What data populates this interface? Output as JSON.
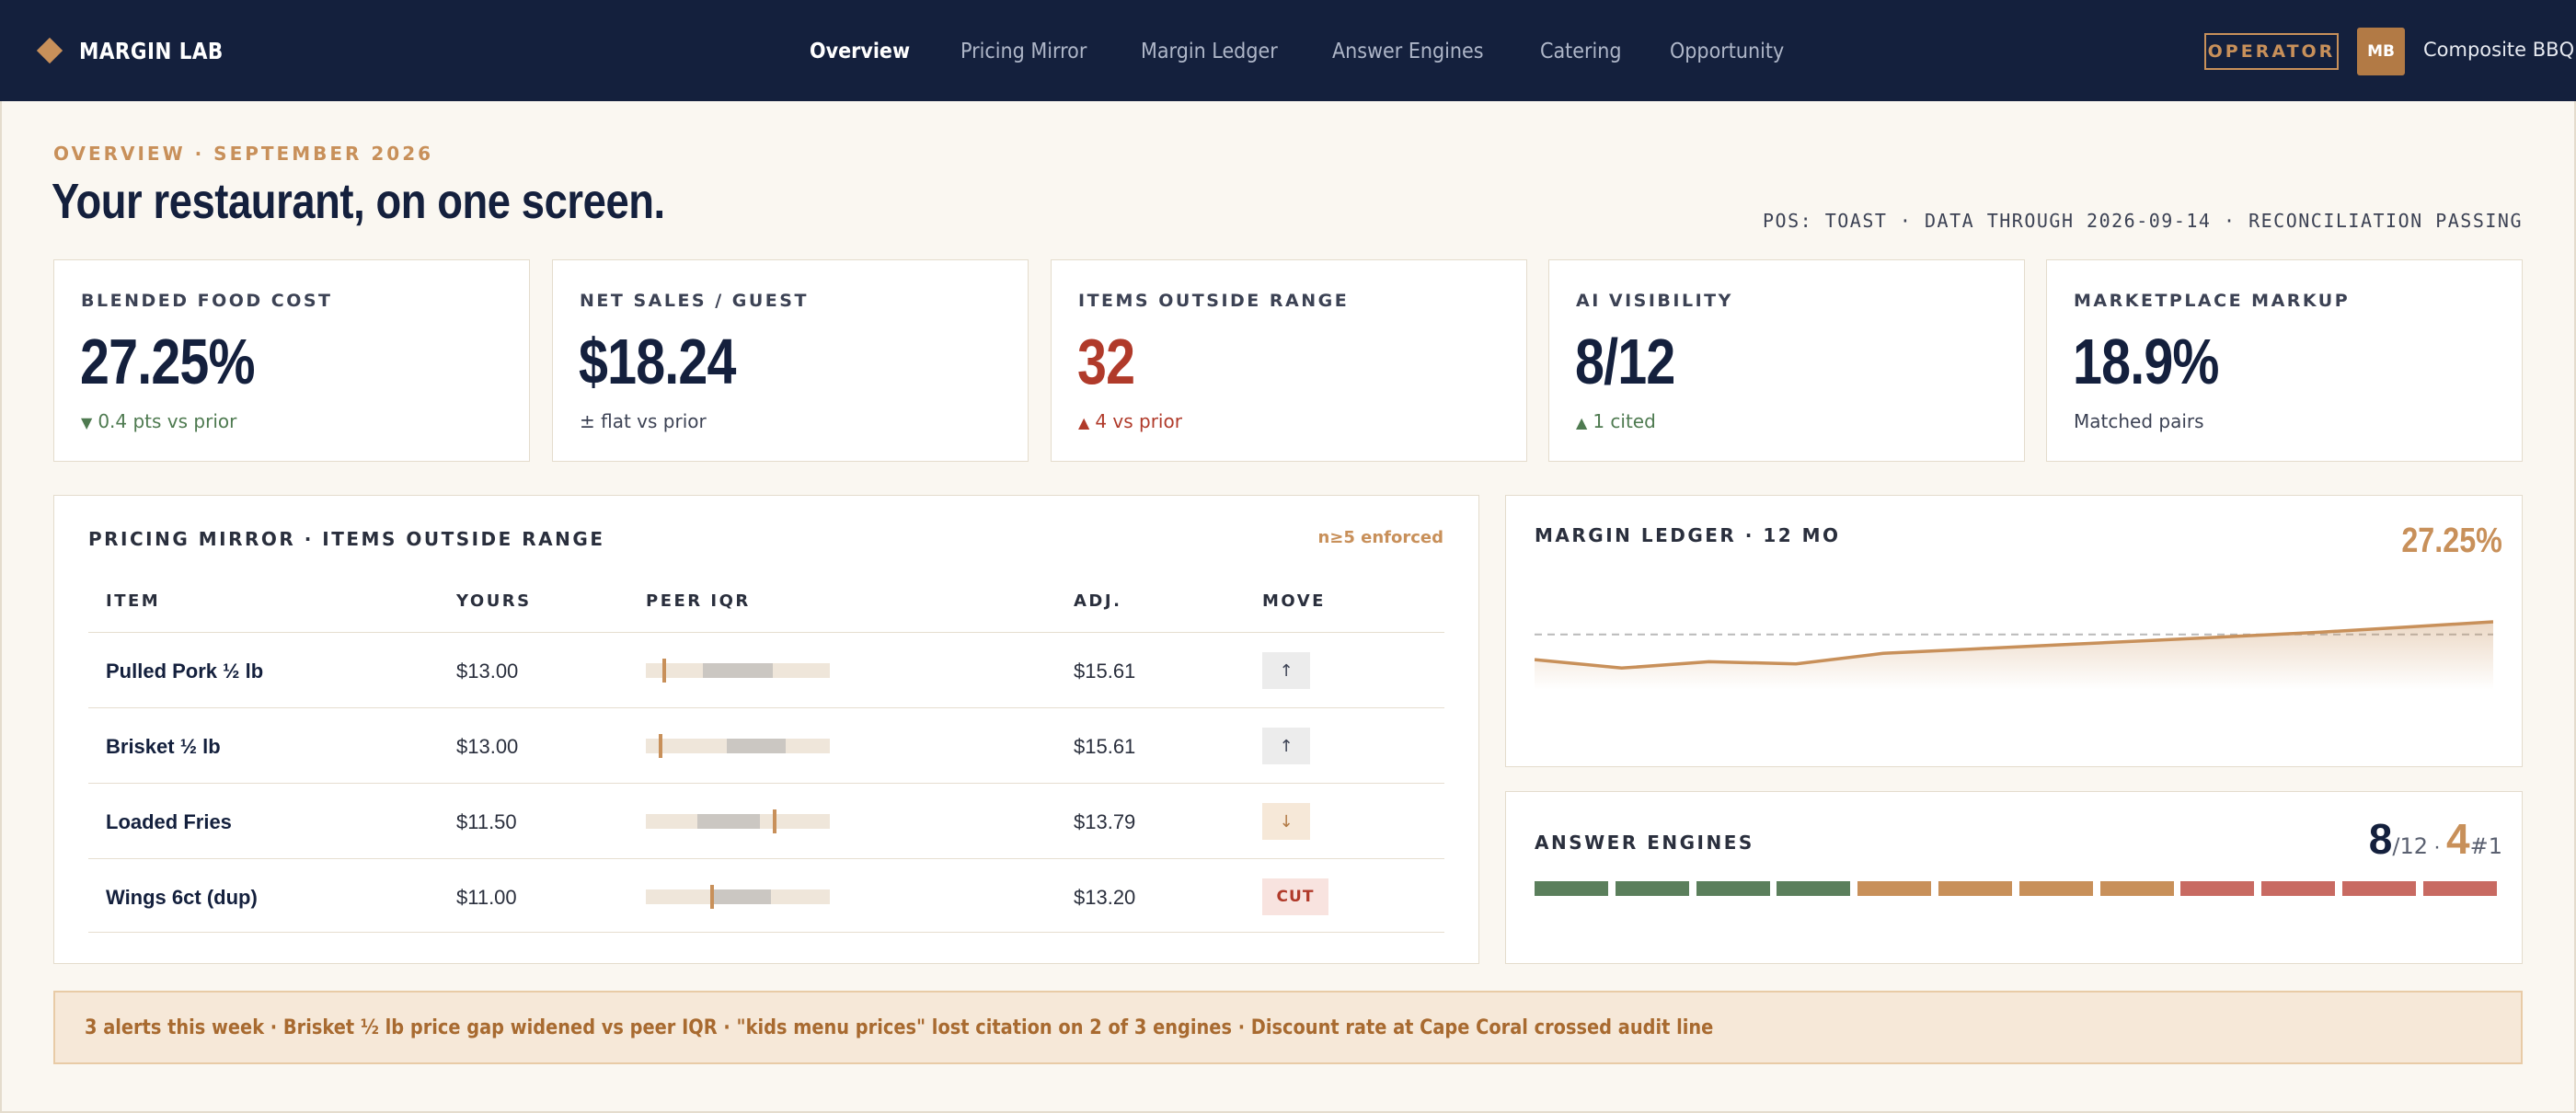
{
  "app": {
    "brand": "MARGIN LAB",
    "nav": [
      "Overview",
      "Pricing Mirror",
      "Margin Ledger",
      "Answer Engines",
      "Catering",
      "Opportunity"
    ],
    "active_nav": "Overview",
    "role_badge": "OPERATOR",
    "avatar_initials": "MB",
    "account_name": "Composite BBQ"
  },
  "header": {
    "eyebrow": "OVERVIEW · SEPTEMBER 2026",
    "title": "Your restaurant, on one screen.",
    "status": "POS: TOAST · DATA THROUGH 2026-09-14 · RECONCILIATION PASSING"
  },
  "kpis": [
    {
      "label": "BLENDED FOOD COST",
      "value": "27.25%",
      "delta_icon": "▼",
      "delta": "0.4 pts vs prior",
      "tone": "good"
    },
    {
      "label": "NET SALES / GUEST",
      "value": "$18.24",
      "delta_icon": "",
      "delta": "± flat vs prior",
      "tone": "neutral"
    },
    {
      "label": "ITEMS OUTSIDE RANGE",
      "value": "32",
      "delta_icon": "▲",
      "delta": "4 vs prior",
      "tone": "bad"
    },
    {
      "label": "AI VISIBILITY",
      "value": "8/12",
      "delta_icon": "▲",
      "delta": "1 cited",
      "tone": "good"
    },
    {
      "label": "MARKETPLACE MARKUP",
      "value": "18.9%",
      "delta_icon": "",
      "delta": "Matched pairs",
      "tone": "neutral"
    }
  ],
  "pricing": {
    "title": "PRICING MIRROR · ITEMS OUTSIDE RANGE",
    "note": "n≥5 enforced",
    "columns": [
      "ITEM",
      "YOURS",
      "PEER IQR",
      "ADJ.",
      "MOVE"
    ],
    "rows": [
      {
        "item": "Pulled Pork ½ lb",
        "yours": "$13.00",
        "adj": "$15.61",
        "move": "↑",
        "move_type": "up",
        "iqr_low": 0.31,
        "iqr_high": 0.69,
        "mark": 0.1
      },
      {
        "item": "Brisket ½ lb",
        "yours": "$13.00",
        "adj": "$15.61",
        "move": "↑",
        "move_type": "up",
        "iqr_low": 0.44,
        "iqr_high": 0.76,
        "mark": 0.08
      },
      {
        "item": "Loaded Fries",
        "yours": "$11.50",
        "adj": "$13.79",
        "move": "↓",
        "move_type": "down",
        "iqr_low": 0.28,
        "iqr_high": 0.62,
        "mark": 0.7
      },
      {
        "item": "Wings 6ct (dup)",
        "yours": "$11.00",
        "adj": "$13.20",
        "move": "CUT",
        "move_type": "cut",
        "iqr_low": 0.37,
        "iqr_high": 0.68,
        "mark": 0.36
      }
    ]
  },
  "ledger": {
    "title": "MARGIN LEDGER · 12 MO",
    "value": "27.25%",
    "chart_data": {
      "type": "area",
      "values": [
        27.5,
        27.9,
        27.6,
        27.7,
        27.2,
        27.0,
        26.8,
        26.6,
        26.4,
        26.2,
        25.95,
        25.7
      ],
      "target": 26.3,
      "ylim": [
        25,
        28.5
      ]
    }
  },
  "answer_engines": {
    "title": "ANSWER ENGINES",
    "score": "8",
    "score_total": "/12",
    "cited": "4",
    "cited_suffix": "#1",
    "bars": [
      "green",
      "green",
      "green",
      "green",
      "gold",
      "gold",
      "gold",
      "gold",
      "red",
      "red",
      "red",
      "red"
    ],
    "colors": {
      "green": "#5b7f5c",
      "gold": "#c8905a",
      "red": "#c86a62"
    }
  },
  "alerts": {
    "text": "3 alerts this week · Brisket ½ lb price gap widened vs peer IQR · \"kids menu prices\" lost citation on 2 of 3 engines · Discount rate at Cape Coral crossed audit line"
  },
  "colors": {
    "navy": "#14203d",
    "accent": "#c8905a",
    "good": "#4e7a50",
    "bad": "#b03a2a",
    "background": "#faf7f1"
  }
}
